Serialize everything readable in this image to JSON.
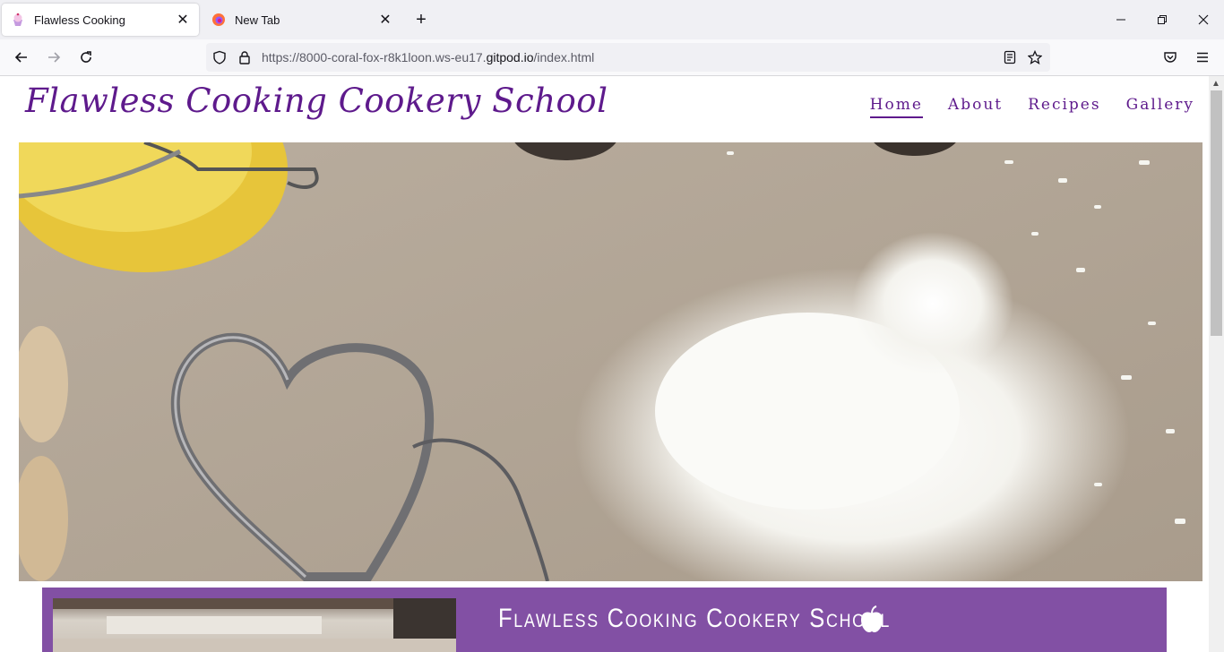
{
  "browser": {
    "tabs": [
      {
        "title": "Flawless Cooking",
        "active": true,
        "icon": "cupcake-favicon"
      },
      {
        "title": "New Tab",
        "active": false,
        "icon": "firefox-favicon"
      }
    ],
    "url": {
      "prefix": "https://8000-coral-fox-r8k1loon.ws-eu17.",
      "host": "gitpod.io",
      "path": "/index.html"
    }
  },
  "site": {
    "logo": "Flawless Cooking Cookery School",
    "nav": [
      {
        "label": "Home",
        "active": true
      },
      {
        "label": "About",
        "active": false
      },
      {
        "label": "Recipes",
        "active": false
      },
      {
        "label": "Gallery",
        "active": false
      }
    ],
    "banner": {
      "heading": "Flawless Cooking Cookery School",
      "icon": "apple-icon"
    }
  },
  "colors": {
    "brand_purple": "#5e1a8c",
    "banner_purple": "#8250a4",
    "chrome_bg": "#f0f0f4"
  }
}
